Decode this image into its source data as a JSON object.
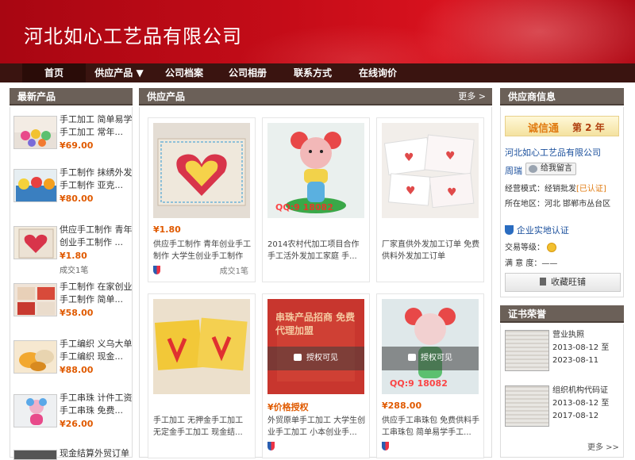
{
  "company_title": "河北如心工艺品有限公司",
  "nav": [
    "首页",
    "供应产品 ▼",
    "公司档案",
    "公司相册",
    "联系方式",
    "在线询价"
  ],
  "left_panel": {
    "title": "最新产品",
    "items": [
      {
        "title": "手工加工 简单易学 手工加工 常年...",
        "price": "¥69.00",
        "sold": ""
      },
      {
        "title": "手工制作 抹绣外发 手工制作 亚克...",
        "price": "¥80.00",
        "sold": ""
      },
      {
        "title": "供应手工制作 青年 创业手工制作 ...",
        "price": "¥1.80",
        "sold": "成交1笔"
      },
      {
        "title": "手工制作 在家创业 手工制作 简单...",
        "price": "¥58.00",
        "sold": ""
      },
      {
        "title": "手工编织 义乌大单 手工编织 现金...",
        "price": "¥88.00",
        "sold": ""
      },
      {
        "title": "手工串珠 计件工资 手工串珠 免费...",
        "price": "¥26.00",
        "sold": ""
      },
      {
        "title": "现金结算外贸订单",
        "price": "",
        "sold": ""
      }
    ]
  },
  "center_panel": {
    "title": "供应产品",
    "more": "更多 >",
    "products": [
      {
        "price": "¥1.80",
        "desc": "供应手工制作 青年创业手工制作 大学生创业手工制作",
        "sold": "成交1笔",
        "watermark": "",
        "locked": false
      },
      {
        "price": "",
        "desc": "2014农村代加工项目合作 手工活外发加工家庭 手...",
        "sold": "",
        "watermark": "QQ:9 18082",
        "locked": false
      },
      {
        "price": "",
        "desc": "厂家直供外发加工订单 免费供料外发加工订单",
        "sold": "",
        "watermark": "",
        "locked": false
      },
      {
        "price": "",
        "desc": "手工加工 无押金手工加工 无定金手工加工 现金结...",
        "sold": "",
        "watermark": "",
        "locked": false
      },
      {
        "price": "¥价格授权",
        "desc": "外贸原单手工加工 大学生创业手工加工 小本创业手...",
        "sold": "",
        "watermark": "串珠产品招商 免费代理加盟",
        "locked": true
      },
      {
        "price": "¥288.00",
        "desc": "供应手工串珠包 免费供料手工串珠包 简单易学手工...",
        "sold": "",
        "watermark": "QQ:9 18082",
        "locked": true
      }
    ],
    "lock_label": "授权可见"
  },
  "right_panel": {
    "title": "供应商信息",
    "chengxin": "诚信通",
    "year": "第 2 年",
    "company_link": "河北如心工艺品有限公司",
    "contact": "周瑞",
    "leave_message": "给我留言",
    "mode_label": "经营模式：",
    "mode_value": "经销批发",
    "certified": "[已认证]",
    "region_label": "所在地区：",
    "region_value": "河北 邯郸市丛台区",
    "verify": "企业实地认证",
    "level_label": "交易等级：",
    "satisfaction_label": "满 意 度：",
    "satisfaction_value": "——",
    "collect": "收藏旺铺"
  },
  "cert_panel": {
    "title": "证书荣誉",
    "items": [
      {
        "name": "营业执照",
        "from": "2013-08-12",
        "to_word": "至",
        "to": "2023-08-11"
      },
      {
        "name": "组织机构代码证",
        "from": "2013-08-12",
        "to_word": "至",
        "to": "2017-08-12"
      }
    ],
    "more": "更多 >>"
  },
  "colors": {
    "banner": "#c50c18",
    "nav": "#3a1410",
    "panel_head": "#6b6058",
    "price": "#e05a00",
    "link": "#1a4f9c"
  }
}
